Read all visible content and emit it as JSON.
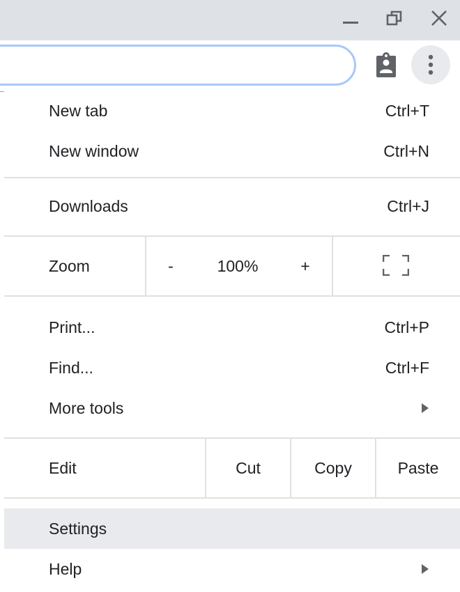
{
  "window_controls": {
    "minimize": "minimize-icon",
    "restore": "restore-icon",
    "close": "close-icon"
  },
  "toolbar": {
    "clipboard_icon": "clipboard-person-icon",
    "menu_icon": "more-vert-icon"
  },
  "menu": {
    "new_tab": {
      "label": "New tab",
      "shortcut": "Ctrl+T"
    },
    "new_window": {
      "label": "New window",
      "shortcut": "Ctrl+N"
    },
    "downloads": {
      "label": "Downloads",
      "shortcut": "Ctrl+J"
    },
    "zoom": {
      "label": "Zoom",
      "minus": "-",
      "value": "100%",
      "plus": "+"
    },
    "print": {
      "label": "Print...",
      "shortcut": "Ctrl+P"
    },
    "find": {
      "label": "Find...",
      "shortcut": "Ctrl+F"
    },
    "more_tools": {
      "label": "More tools"
    },
    "edit": {
      "label": "Edit",
      "cut": "Cut",
      "copy": "Copy",
      "paste": "Paste"
    },
    "settings": {
      "label": "Settings"
    },
    "help": {
      "label": "Help"
    }
  },
  "colors": {
    "titlebar": "#dee1e6",
    "highlight": "#e8eaed",
    "omnibox_border": "#a8c7fa",
    "icon": "#5f6368"
  }
}
